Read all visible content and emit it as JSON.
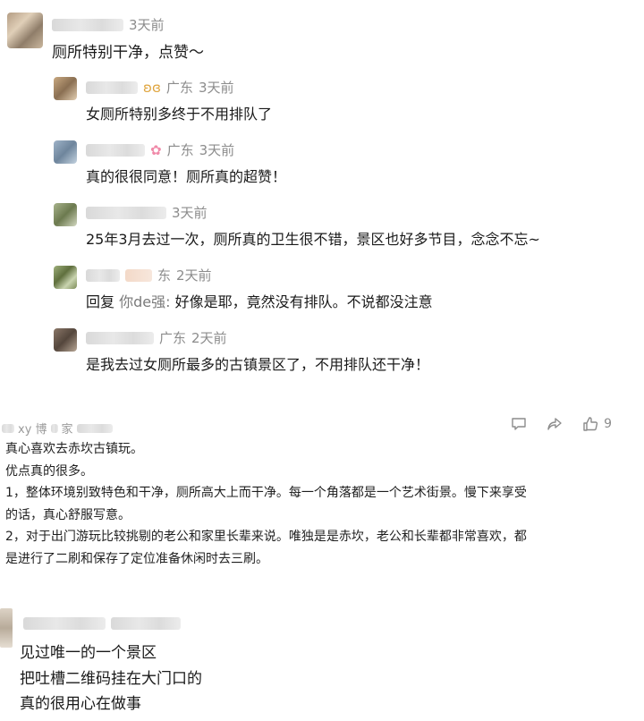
{
  "thread": {
    "top_comment": {
      "time": "3天前",
      "text": "厕所特别干净，点赞～"
    },
    "replies": [
      {
        "location": "广东",
        "time": "3天前",
        "text": "女厕所特别多终于不用排队了",
        "badge_icon": "butterfly-icon"
      },
      {
        "location": "广东",
        "time": "3天前",
        "text": "真的很很同意！厕所真的超赞！",
        "badge_icon": "flower-icon"
      },
      {
        "location": "",
        "time": "3天前",
        "text": "25年3月去过一次，厕所真的卫生很不错，景区也好多节目，念念不忘~"
      },
      {
        "location": "东",
        "time": "2天前",
        "reply_prefix": "回复 ",
        "reply_to": "你de强",
        "reply_colon": ":",
        "text": " 好像是耶，竟然没有排队。不说都没注意"
      },
      {
        "location": "广东",
        "time": "2天前",
        "text": "是我去过女厕所最多的古镇景区了，不用排队还干净！"
      }
    ]
  },
  "comment2": {
    "user_fragment_a": "xy 博",
    "user_fragment_b": "家",
    "reply_icon": "comment-icon",
    "share_icon": "share-icon",
    "like_icon": "thumbs-up-icon",
    "like_count": "9",
    "lines": [
      "真心喜欢去赤坎古镇玩。",
      "优点真的很多。",
      "1，整体环境别致特色和干净，厕所高大上而干净。每一个角落都是一个艺术街景。慢下来享受",
      "的话，真心舒服写意。",
      "2，对于出门游玩比较挑剔的老公和家里长辈来说。唯独是是赤坎，老公和长辈都非常喜欢，都",
      "是进行了二刷和保存了定位准备休闲时去三刷。"
    ]
  },
  "comment3": {
    "lines": [
      "见过唯一的一个景区",
      "把吐槽二维码挂在大门口的",
      "真的很用心在做事"
    ]
  }
}
